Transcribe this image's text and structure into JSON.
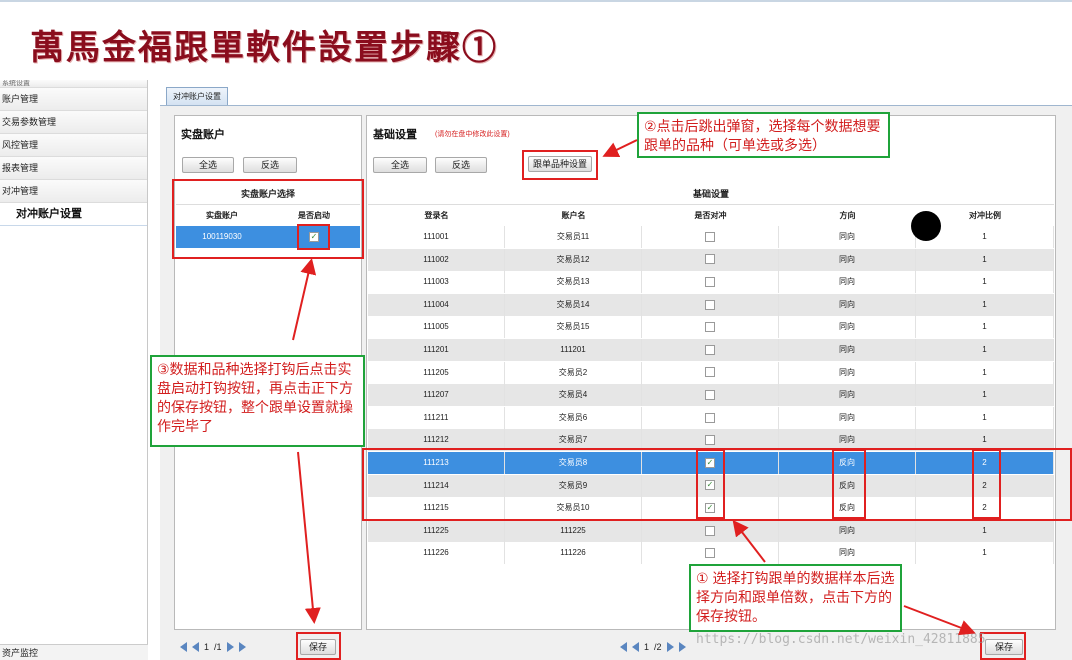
{
  "banner": {
    "title": "萬馬金福跟單軟件設置步驟①"
  },
  "sidebar": {
    "items": [
      "系统设置",
      "账户管理",
      "交易参数管理",
      "风控管理",
      "报表管理",
      "对冲管理"
    ],
    "active": "对冲账户设置",
    "bottom": "资产监控"
  },
  "tab": {
    "label": "对冲账户设置"
  },
  "left_panel": {
    "title": "实盘账户",
    "select_all": "全选",
    "invert": "反选",
    "grid_title": "实盘账户选择",
    "columns": [
      "实盘账户",
      "是否启动"
    ],
    "rows": [
      {
        "account": "100119030",
        "enabled": "✓"
      }
    ],
    "pager": {
      "page": "1",
      "sep": "/1"
    },
    "save": "保存"
  },
  "right_panel": {
    "title": "基础设置",
    "hint": "(请勿在盘中修改此设置)",
    "select_all": "全选",
    "invert": "反选",
    "product_button": "跟单品种设置",
    "grid_title": "基础设置",
    "columns": [
      "登录名",
      "账户名",
      "是否对冲",
      "方向",
      "对冲比例"
    ],
    "rows": [
      {
        "login": "111001",
        "name": "交易员11",
        "hedge": "",
        "dir": "同向",
        "ratio": "1"
      },
      {
        "login": "111002",
        "name": "交易员12",
        "hedge": "",
        "dir": "同向",
        "ratio": "1"
      },
      {
        "login": "111003",
        "name": "交易员13",
        "hedge": "",
        "dir": "同向",
        "ratio": "1"
      },
      {
        "login": "111004",
        "name": "交易员14",
        "hedge": "",
        "dir": "同向",
        "ratio": "1"
      },
      {
        "login": "111005",
        "name": "交易员15",
        "hedge": "",
        "dir": "同向",
        "ratio": "1"
      },
      {
        "login": "111201",
        "name": "111201",
        "hedge": "",
        "dir": "同向",
        "ratio": "1"
      },
      {
        "login": "111205",
        "name": "交易员2",
        "hedge": "",
        "dir": "同向",
        "ratio": "1"
      },
      {
        "login": "111207",
        "name": "交易员4",
        "hedge": "",
        "dir": "同向",
        "ratio": "1"
      },
      {
        "login": "111211",
        "name": "交易员6",
        "hedge": "",
        "dir": "同向",
        "ratio": "1"
      },
      {
        "login": "111212",
        "name": "交易员7",
        "hedge": "",
        "dir": "同向",
        "ratio": "1"
      },
      {
        "login": "111213",
        "name": "交易员8",
        "hedge": "✓",
        "dir": "反向",
        "ratio": "2"
      },
      {
        "login": "111214",
        "name": "交易员9",
        "hedge": "✓",
        "dir": "反向",
        "ratio": "2"
      },
      {
        "login": "111215",
        "name": "交易员10",
        "hedge": "✓",
        "dir": "反向",
        "ratio": "2"
      },
      {
        "login": "111225",
        "name": "111225",
        "hedge": "",
        "dir": "同向",
        "ratio": "1"
      },
      {
        "login": "111226",
        "name": "111226",
        "hedge": "",
        "dir": "同向",
        "ratio": "1"
      }
    ],
    "pager": {
      "page": "1",
      "sep": "/2"
    },
    "save": "保存"
  },
  "annotations": {
    "step1": "① 选择打钩跟单的数据样本后选择方向和跟单倍数，点击下方的保存按钮。",
    "step2": "②点击后跳出弹窗，选择每个数据想要跟单的品种（可单选或多选）",
    "step3": "③数据和品种选择打钩后点击实盘启动打钩按钮，再点击正下方的保存按钮，整个跟单设置就操作完毕了"
  },
  "watermark": "https://blog.csdn.net/weixin_42811885",
  "colors": {
    "annotation_red": "#e02020",
    "annotation_green": "#1fa33a",
    "selected_row": "#3d8fe0",
    "banner_text": "#8a0d1d"
  }
}
